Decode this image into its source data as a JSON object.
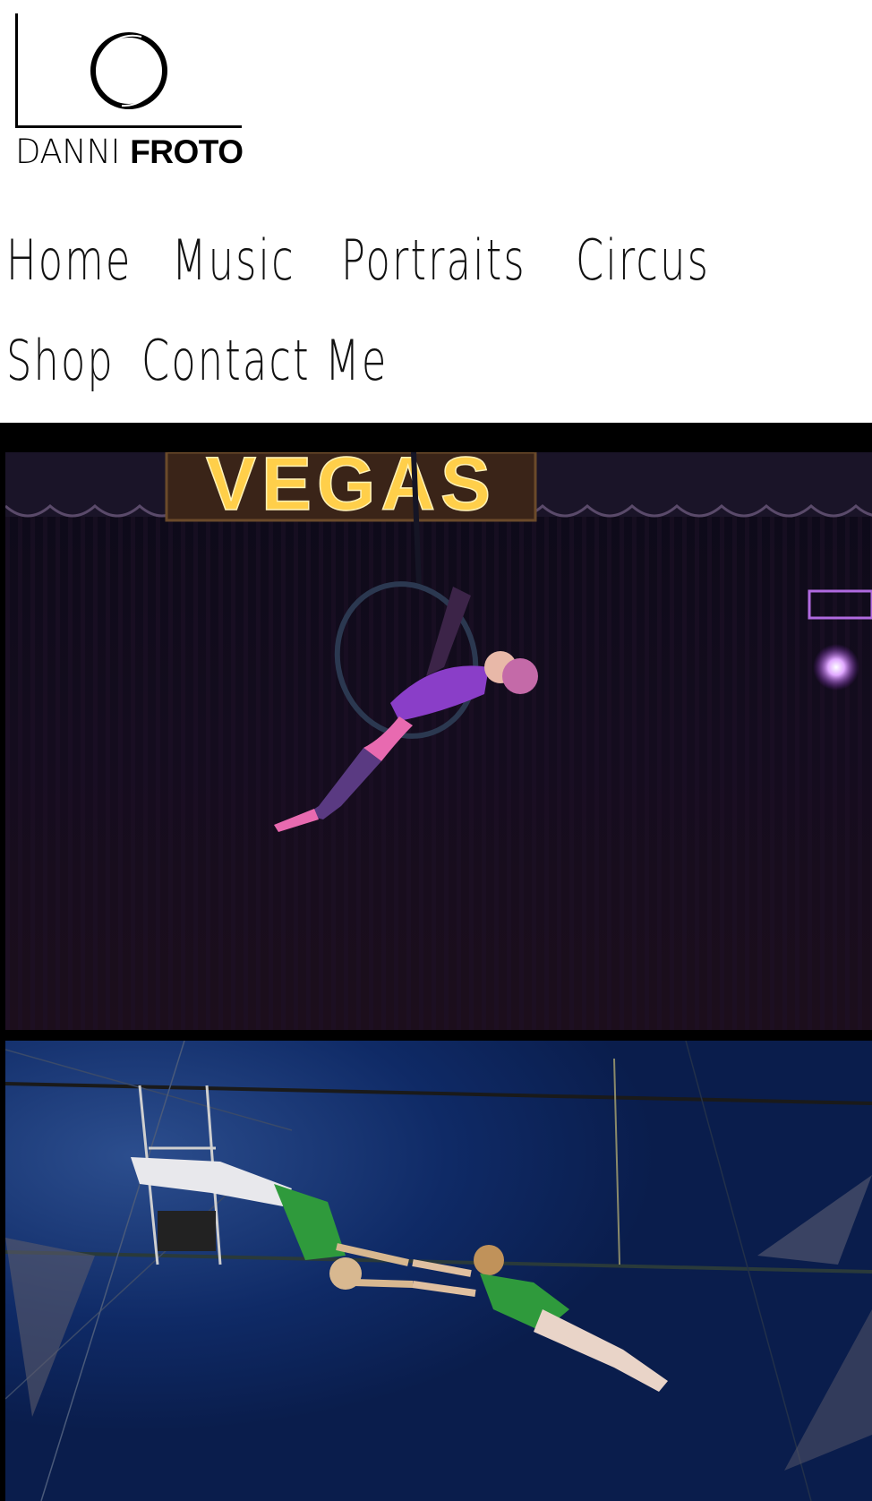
{
  "logo": {
    "word1": "DANNI",
    "word2": "FROTO"
  },
  "nav": {
    "items": [
      {
        "label": "Home"
      },
      {
        "label": "Music"
      },
      {
        "label": "Portraits"
      },
      {
        "label": "Circus"
      },
      {
        "label": "Shop"
      },
      {
        "label": "Contact Me"
      }
    ]
  },
  "gallery": {
    "photo1": {
      "sign_text": "VEGAS"
    }
  },
  "colors": {
    "background": "#ffffff",
    "text": "#111111",
    "gallery_background": "#000000",
    "marquee_bulb": "#ffcf4a",
    "stage_purple": "#1a0f22",
    "tent_blue": "#0b1f55",
    "costume_green": "#2f9a3c",
    "costume_pink": "#e86ab0"
  }
}
